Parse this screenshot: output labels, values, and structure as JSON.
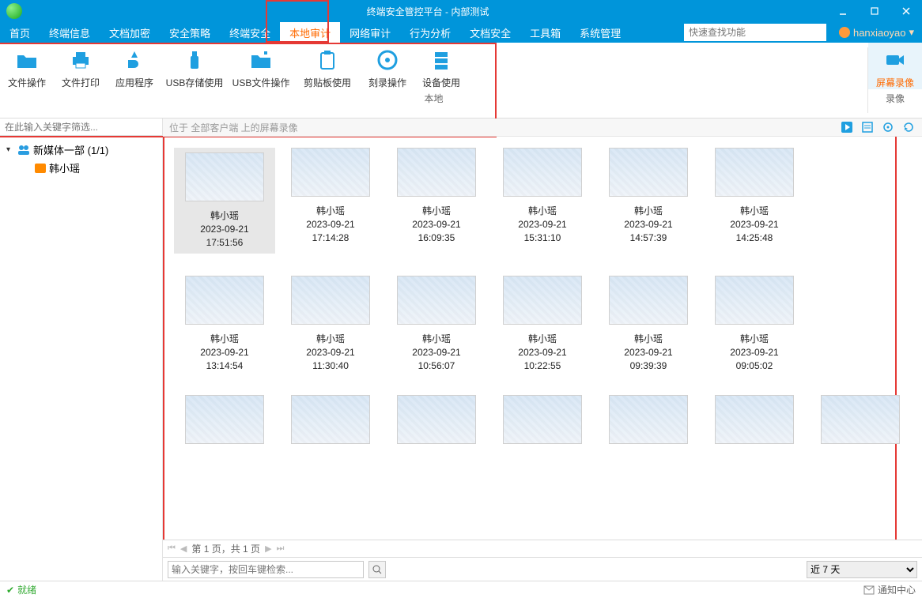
{
  "title": "终端安全管控平台 - 内部测试",
  "window_controls": {
    "min": "minimize",
    "max": "maximize",
    "close": "close"
  },
  "menu": {
    "items": [
      "首页",
      "终端信息",
      "文档加密",
      "安全策略",
      "终端安全",
      "本地审计",
      "网络审计",
      "行为分析",
      "文档安全",
      "工具箱",
      "系统管理"
    ],
    "active_index": 5,
    "search_placeholder": "快速查找功能",
    "user": "hanxiaoyao"
  },
  "ribbon": {
    "group1_label": "本地",
    "group2_label": "录像",
    "tools": [
      {
        "label": "文件操作",
        "icon": "folder"
      },
      {
        "label": "文件打印",
        "icon": "printer"
      },
      {
        "label": "应用程序",
        "icon": "app"
      },
      {
        "label": "USB存储使用",
        "icon": "usb"
      },
      {
        "label": "USB文件操作",
        "icon": "usb-folder"
      },
      {
        "label": "剪贴板使用",
        "icon": "clipboard"
      },
      {
        "label": "刻录操作",
        "icon": "disc"
      },
      {
        "label": "设备使用",
        "icon": "server"
      }
    ],
    "active_tool": {
      "label": "屏幕录像",
      "icon": "camera"
    }
  },
  "sidebar": {
    "filter_placeholder": "在此输入关键字筛选...",
    "group_label": "新媒体一部 (1/1)",
    "child_label": "韩小瑶"
  },
  "main": {
    "crumb": "位于 全部客户端 上的屏幕录像",
    "toolbar_icons": [
      "play",
      "list",
      "settings",
      "refresh"
    ],
    "pager_text": "第 1 页，共 1 页",
    "search_placeholder": "输入关键字，按回车键检索...",
    "range_value": "近 7 天"
  },
  "items": [
    {
      "name": "韩小瑶",
      "date": "2023-09-21",
      "time": "17:51:56"
    },
    {
      "name": "韩小瑶",
      "date": "2023-09-21",
      "time": "17:14:28"
    },
    {
      "name": "韩小瑶",
      "date": "2023-09-21",
      "time": "16:09:35"
    },
    {
      "name": "韩小瑶",
      "date": "2023-09-21",
      "time": "15:31:10"
    },
    {
      "name": "韩小瑶",
      "date": "2023-09-21",
      "time": "14:57:39"
    },
    {
      "name": "韩小瑶",
      "date": "2023-09-21",
      "time": "14:25:48"
    },
    {
      "name": "韩小瑶",
      "date": "2023-09-21",
      "time": "13:14:54"
    },
    {
      "name": "韩小瑶",
      "date": "2023-09-21",
      "time": "11:30:40"
    },
    {
      "name": "韩小瑶",
      "date": "2023-09-21",
      "time": "10:56:07"
    },
    {
      "name": "韩小瑶",
      "date": "2023-09-21",
      "time": "10:22:55"
    },
    {
      "name": "韩小瑶",
      "date": "2023-09-21",
      "time": "09:39:39"
    },
    {
      "name": "韩小瑶",
      "date": "2023-09-21",
      "time": "09:05:02"
    }
  ],
  "items_partial_row": 7,
  "status": {
    "text": "就绪",
    "right": "通知中心"
  }
}
